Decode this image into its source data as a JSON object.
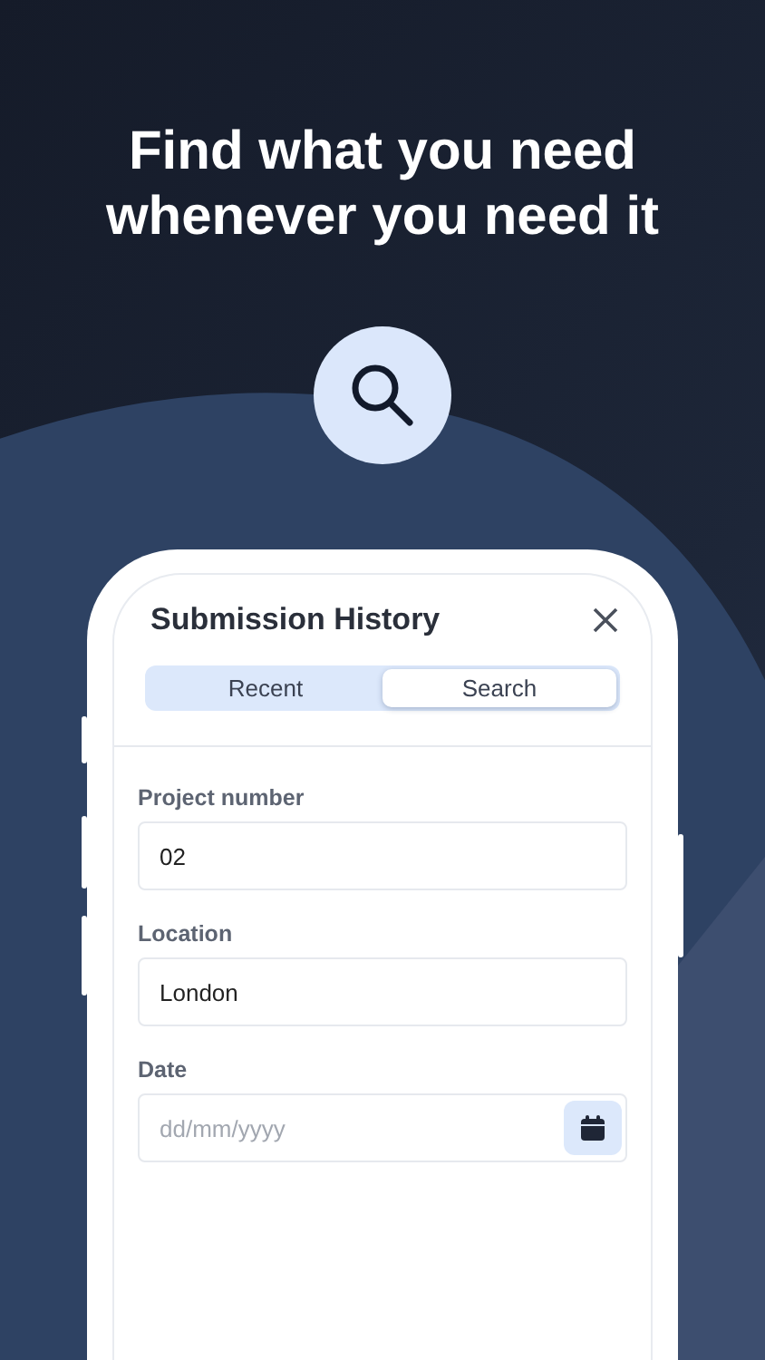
{
  "headline": "Find what you need whenever you need it",
  "dialog": {
    "title": "Submission History",
    "tabs": [
      {
        "label": "Recent",
        "selected": false
      },
      {
        "label": "Search",
        "selected": true
      }
    ],
    "fields": [
      {
        "kind": "text",
        "label": "Project number",
        "value": "02"
      },
      {
        "kind": "text",
        "label": "Location",
        "value": "London"
      },
      {
        "kind": "date",
        "label": "Date",
        "placeholder": "dd/mm/yyyy"
      }
    ]
  }
}
